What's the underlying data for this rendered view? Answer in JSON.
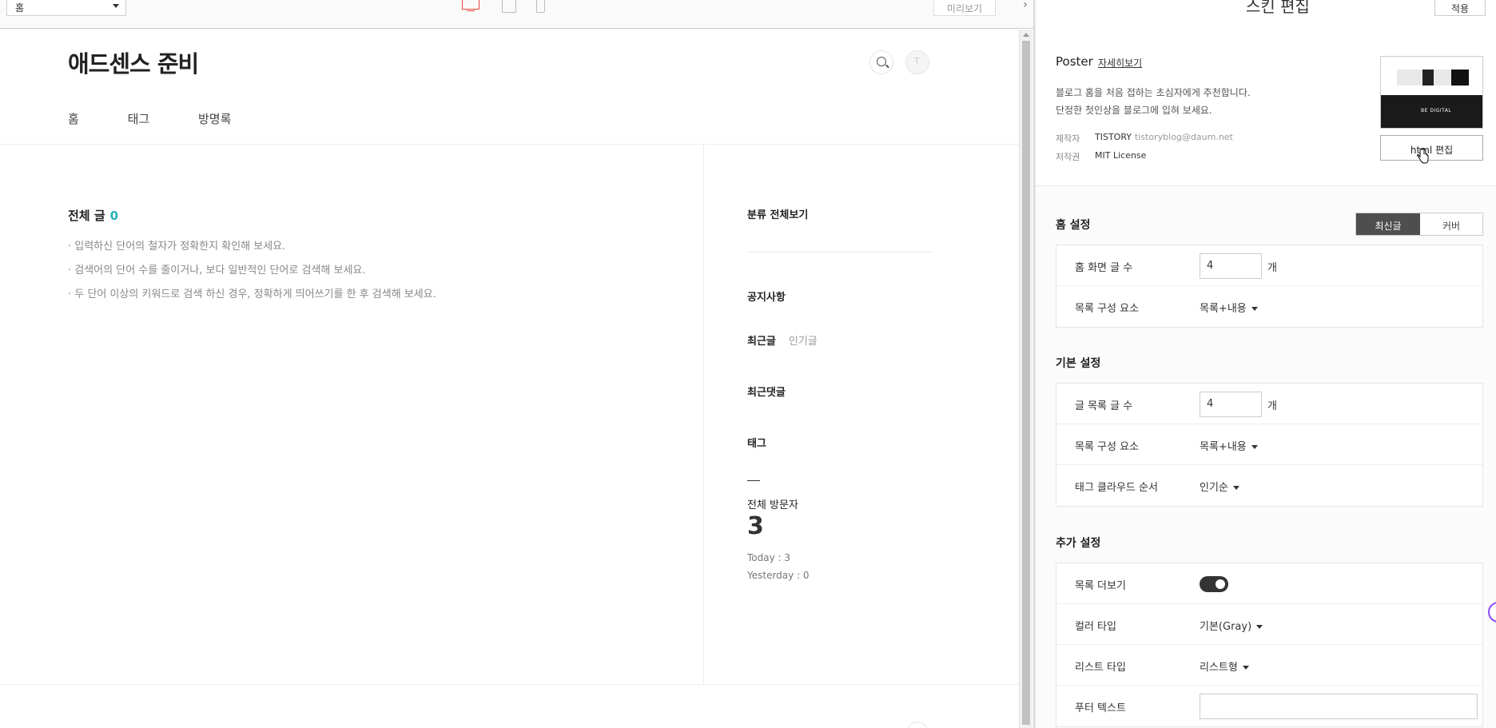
{
  "toolbar": {
    "page_select_value": "홈",
    "preview_label": "미리보기",
    "panel_toggle": "›"
  },
  "blog": {
    "title": "애드센스 준비",
    "nav": [
      "홈",
      "태그",
      "방명록"
    ],
    "all_posts_label": "전체 글",
    "all_posts_count": "0",
    "hints": [
      "입력하신 단어의 철자가 정확한지 확인해 보세요.",
      "검색어의 단어 수를 줄이거나, 보다 일반적인 단어로 검색해 보세요.",
      "두 단어 이상의 키워드로 검색 하신 경우, 정확하게 띄어쓰기를 한 후 검색해 보세요."
    ],
    "sidebar": {
      "category_all": "분류 전체보기",
      "notice": "공지사항",
      "recent": "최근글",
      "popular": "인기글",
      "recent_comments": "최근댓글",
      "tags": "태그",
      "visitors_label": "전체 방문자",
      "visitors_total": "3",
      "today": "Today : 3",
      "yesterday": "Yesterday : 0"
    }
  },
  "panel": {
    "title": "스킨 편집",
    "apply_label": "적용",
    "skin": {
      "name": "Poster",
      "more_link": "자세히보기",
      "desc_line1": "블로그 홈을 처음 접하는 초심자에게 추천합니다.",
      "desc_line2": "단정한 첫인상을 블로그에 입혀 보세요.",
      "author_label": "제작자",
      "author_name": "TISTORY",
      "author_email": "tistoryblog@daum.net",
      "license_label": "저작권",
      "license_value": "MIT License",
      "thumb_text": "BE DIGITAL",
      "html_edit_label": "html 편집"
    },
    "home_settings": {
      "title": "홈 설정",
      "seg_active": "최신글",
      "seg_other": "커버",
      "rows": [
        {
          "label": "홈 화면 글 수",
          "value": "4",
          "unit": "개"
        },
        {
          "label": "목록 구성 요소",
          "value": "목록+내용"
        }
      ]
    },
    "basic_settings": {
      "title": "기본 설정",
      "rows": [
        {
          "label": "글 목록 글 수",
          "value": "4",
          "unit": "개"
        },
        {
          "label": "목록 구성 요소",
          "value": "목록+내용"
        },
        {
          "label": "태그 클라우드 순서",
          "value": "인기순"
        }
      ]
    },
    "extra_settings": {
      "title": "추가 설정",
      "rows": [
        {
          "label": "목록 더보기",
          "toggle": "on"
        },
        {
          "label": "컬러 타입",
          "value": "기본(Gray)"
        },
        {
          "label": "리스트 타입",
          "value": "리스트형"
        },
        {
          "label": "푸터 텍스트",
          "value": ""
        }
      ]
    }
  },
  "colors": {
    "accent_teal": "#26b0b6",
    "active_device": "#e6463a",
    "segment_active": "#4e4e4e"
  }
}
